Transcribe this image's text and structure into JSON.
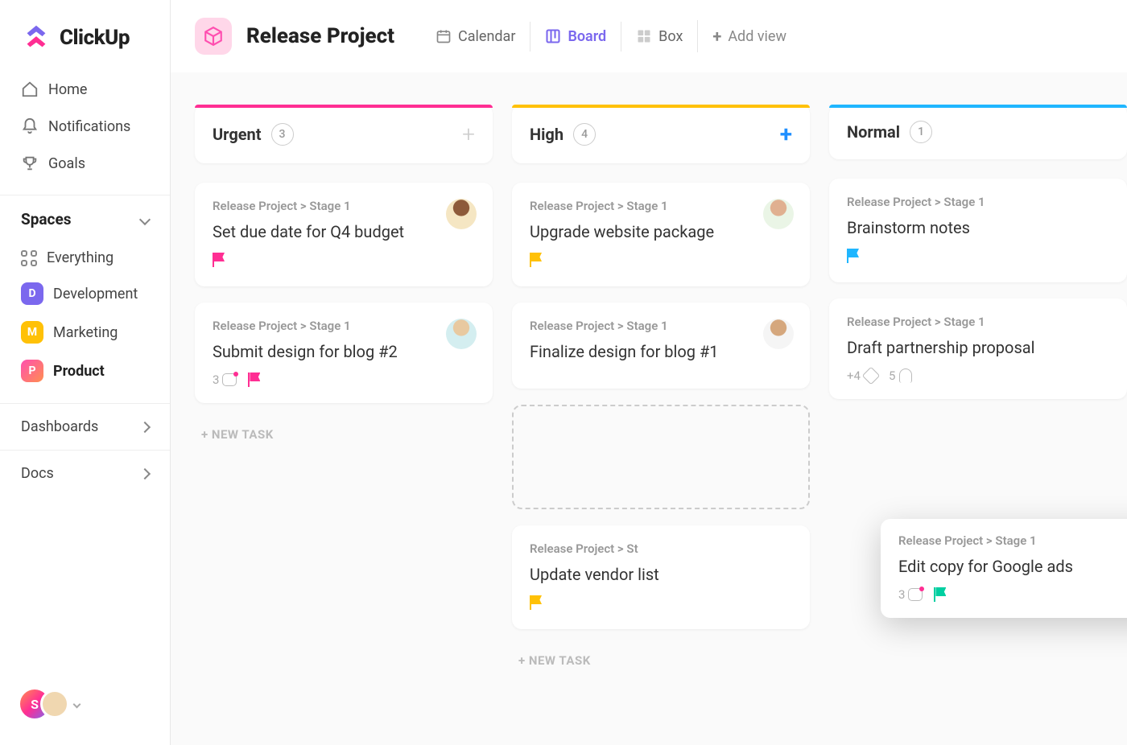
{
  "app_name": "ClickUp",
  "nav": {
    "home": "Home",
    "notifications": "Notifications",
    "goals": "Goals"
  },
  "spaces": {
    "header": "Spaces",
    "everything": "Everything",
    "items": [
      {
        "letter": "D",
        "label": "Development",
        "color": "#7b68ee"
      },
      {
        "letter": "M",
        "label": "Marketing",
        "color": "#ffc107"
      },
      {
        "letter": "P",
        "label": "Product",
        "color": "#ff4fb0"
      }
    ]
  },
  "sections": {
    "dashboards": "Dashboards",
    "docs": "Docs"
  },
  "user_badge_letter": "S",
  "header": {
    "title": "Release Project",
    "views": {
      "calendar": "Calendar",
      "board": "Board",
      "box": "Box",
      "add": "Add view"
    }
  },
  "columns": {
    "urgent": {
      "title": "Urgent",
      "count": "3",
      "cards": [
        {
          "path": "Release Project > Stage 1",
          "title": "Set due date for Q4 budget"
        },
        {
          "path": "Release Project > Stage 1",
          "title": "Submit design for blog #2",
          "comments": "3"
        }
      ],
      "new_task": "+ NEW TASK"
    },
    "high": {
      "title": "High",
      "count": "4",
      "cards": [
        {
          "path": "Release Project > Stage 1",
          "title": "Upgrade website package"
        },
        {
          "path": "Release Project > Stage 1",
          "title": "Finalize design for blog #1"
        },
        {
          "path": "Release Project > St",
          "title": "Update vendor list"
        }
      ],
      "new_task": "+ NEW TASK"
    },
    "normal": {
      "title": "Normal",
      "count": "1",
      "cards": [
        {
          "path": "Release Project > Stage 1",
          "title": "Brainstorm notes"
        },
        {
          "path": "Release Project > Stage 1",
          "title": "Draft partnership proposal",
          "tags": "+4",
          "attachments": "5"
        }
      ]
    }
  },
  "drag_card": {
    "path": "Release Project > Stage 1",
    "title": "Edit copy for Google ads",
    "comments": "3"
  }
}
